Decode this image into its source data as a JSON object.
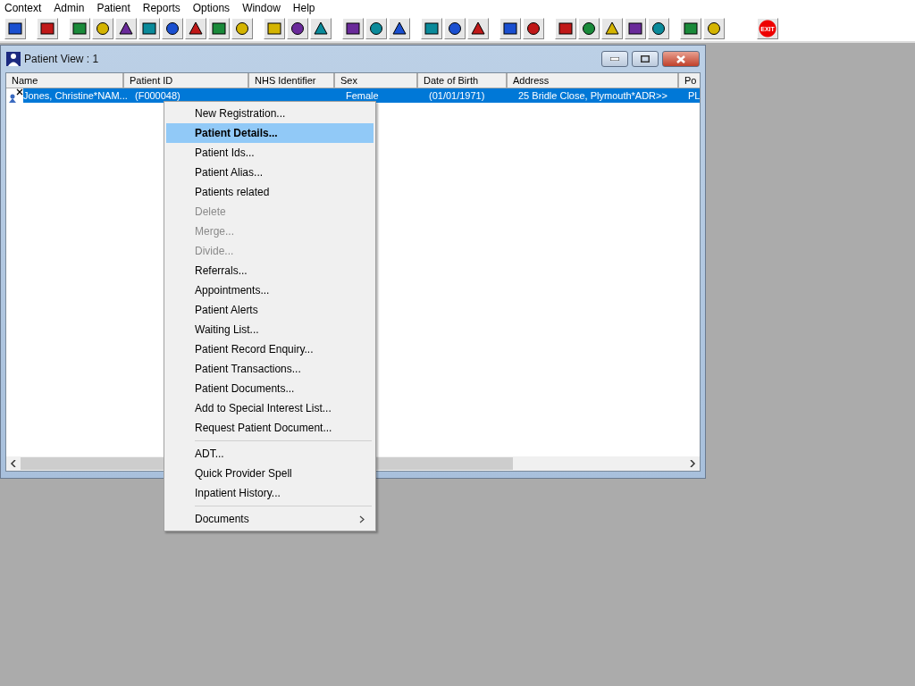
{
  "menu_bar": [
    "Context",
    "Admin",
    "Patient",
    "Reports",
    "Options",
    "Window",
    "Help"
  ],
  "toolbar": {
    "exit_label": "EXIT"
  },
  "window": {
    "title": "Patient View : 1",
    "columns": [
      "Name",
      "Patient ID",
      "NHS Identifier",
      "Sex",
      "Date of Birth",
      "Address",
      "Po"
    ],
    "rows": [
      {
        "cells": [
          "Jones, Christine*NAM...",
          "(F000048)",
          "",
          "Female",
          "(01/01/1971)",
          "25 Bridle Close, Plymouth*ADR>>",
          "PL"
        ],
        "selected": true
      }
    ]
  },
  "context_menu": [
    [
      {
        "label": "New Registration...",
        "selected": false,
        "disabled": false
      },
      {
        "label": "Patient Details...",
        "selected": true,
        "disabled": false
      },
      {
        "label": "Patient Ids...",
        "selected": false,
        "disabled": false
      },
      {
        "label": "Patient Alias...",
        "selected": false,
        "disabled": false
      },
      {
        "label": "Patients related",
        "selected": false,
        "disabled": false
      },
      {
        "label": "Delete",
        "selected": false,
        "disabled": true
      },
      {
        "label": "Merge...",
        "selected": false,
        "disabled": true
      },
      {
        "label": "Divide...",
        "selected": false,
        "disabled": true
      },
      {
        "label": "Referrals...",
        "selected": false,
        "disabled": false
      },
      {
        "label": "Appointments...",
        "selected": false,
        "disabled": false
      },
      {
        "label": "Patient Alerts",
        "selected": false,
        "disabled": false
      },
      {
        "label": "Waiting List...",
        "selected": false,
        "disabled": false
      },
      {
        "label": "Patient Record Enquiry...",
        "selected": false,
        "disabled": false
      },
      {
        "label": "Patient Transactions...",
        "selected": false,
        "disabled": false
      },
      {
        "label": "Patient Documents...",
        "selected": false,
        "disabled": false
      },
      {
        "label": "Add to Special Interest List...",
        "selected": false,
        "disabled": false
      },
      {
        "label": "Request Patient Document...",
        "selected": false,
        "disabled": false
      }
    ],
    [
      {
        "label": "ADT...",
        "selected": false,
        "disabled": false
      },
      {
        "label": "Quick Provider Spell",
        "selected": false,
        "disabled": false
      },
      {
        "label": "Inpatient History...",
        "selected": false,
        "disabled": false
      }
    ],
    [
      {
        "label": "Documents",
        "selected": false,
        "disabled": false,
        "submenu": true
      }
    ]
  ]
}
